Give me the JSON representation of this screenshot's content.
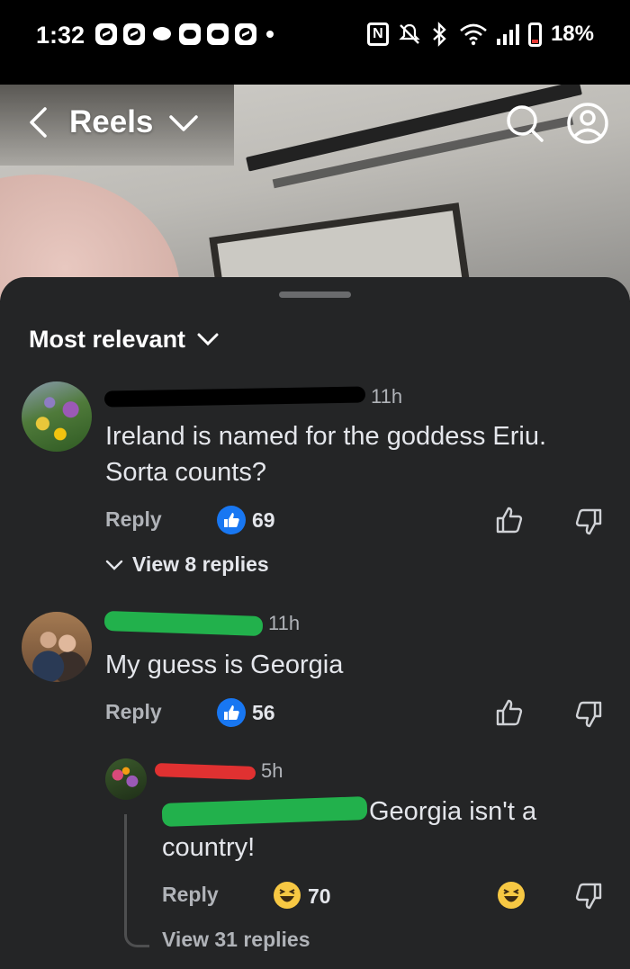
{
  "status_bar": {
    "time": "1:32",
    "battery_percent": "18%",
    "left_icons": [
      "messenger-icon",
      "messenger-icon",
      "chat-bubble-icon",
      "discord-icon",
      "discord-icon",
      "messenger-icon"
    ],
    "right_icons": [
      "nfc-icon",
      "mute-icon",
      "bluetooth-icon",
      "wifi-icon",
      "signal-icon",
      "battery-icon"
    ]
  },
  "header": {
    "title": "Reels",
    "back_icon": "chevron-left-icon",
    "dropdown_icon": "chevron-down-icon",
    "search_icon": "search-icon",
    "profile_icon": "profile-icon"
  },
  "sort": {
    "label": "Most relevant"
  },
  "comments": [
    {
      "time": "11h",
      "text_line1": "Ireland is named for the goddess Eriu.",
      "text_line2": "Sorta counts?",
      "reply_label": "Reply",
      "reaction": "like",
      "reaction_count": "69",
      "view_replies": "View 8 replies"
    },
    {
      "time": "11h",
      "text_line1": "My guess is Georgia",
      "reply_label": "Reply",
      "reaction": "like",
      "reaction_count": "56"
    }
  ],
  "reply": {
    "time": "5h",
    "text_line1": "Georgia isn't a",
    "text_line2": "country!",
    "reply_label": "Reply",
    "reaction": "haha",
    "reaction_count": "70",
    "view_replies": "View 31 replies"
  },
  "colors": {
    "sheet_bg": "#242526",
    "like_blue": "#1877f2",
    "haha_yellow": "#f7c843",
    "redaction_black": "#000000",
    "redaction_green": "#22b14c",
    "redaction_red": "#e03131"
  }
}
